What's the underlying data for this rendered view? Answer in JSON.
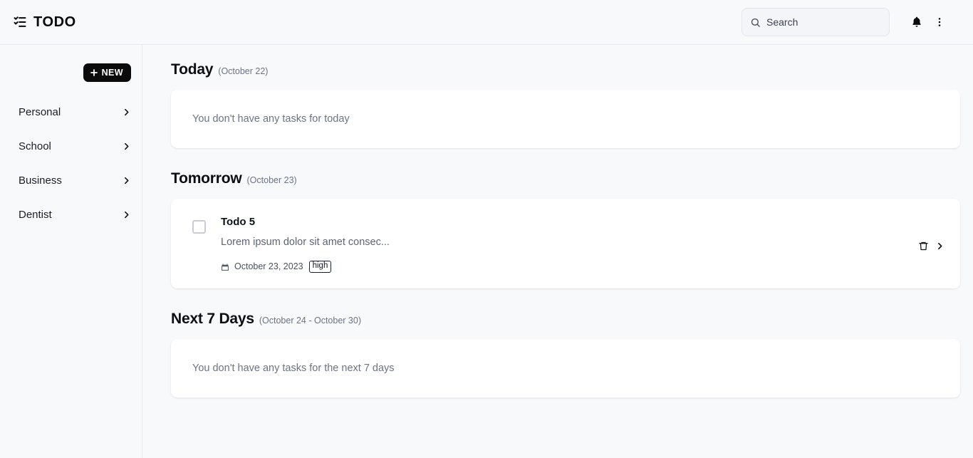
{
  "header": {
    "brand_icon": "list-checks-icon",
    "brand_title": "TODO",
    "search": {
      "icon": "search-icon",
      "placeholder": "Search",
      "value": ""
    },
    "notifications_icon": "bell-icon",
    "overflow_icon": "kebab-vertical-icon"
  },
  "sidebar": {
    "new_button": {
      "icon": "plus-icon",
      "label": "NEW"
    },
    "items": [
      {
        "label": "Personal",
        "chevron": "chevron-right-icon"
      },
      {
        "label": "School",
        "chevron": "chevron-right-icon"
      },
      {
        "label": "Business",
        "chevron": "chevron-right-icon"
      },
      {
        "label": "Dentist",
        "chevron": "chevron-right-icon"
      }
    ]
  },
  "main": {
    "sections": [
      {
        "title": "Today",
        "range": "(October 22)",
        "empty_text": "You don't have any tasks for today",
        "todos": []
      },
      {
        "title": "Tomorrow",
        "range": "(October 23)",
        "empty_text": "",
        "todos": [
          {
            "checked": false,
            "title": "Todo 5",
            "description": "Lorem ipsum dolor sit amet consec...",
            "date_icon": "calendar-icon",
            "date": "October 23, 2023",
            "priority": "high",
            "delete_icon": "trash-icon",
            "open_icon": "chevron-right-icon"
          }
        ]
      },
      {
        "title": "Next 7 Days",
        "range": "(October 24 - October 30)",
        "empty_text": "You don't have any tasks for the next 7 days",
        "todos": []
      }
    ]
  },
  "colors": {
    "page_background": "#f8f9fb",
    "card_background": "#ffffff",
    "accent": "#0b0b0b",
    "border": "#e7e9ee",
    "muted_text": "#6d7383"
  }
}
